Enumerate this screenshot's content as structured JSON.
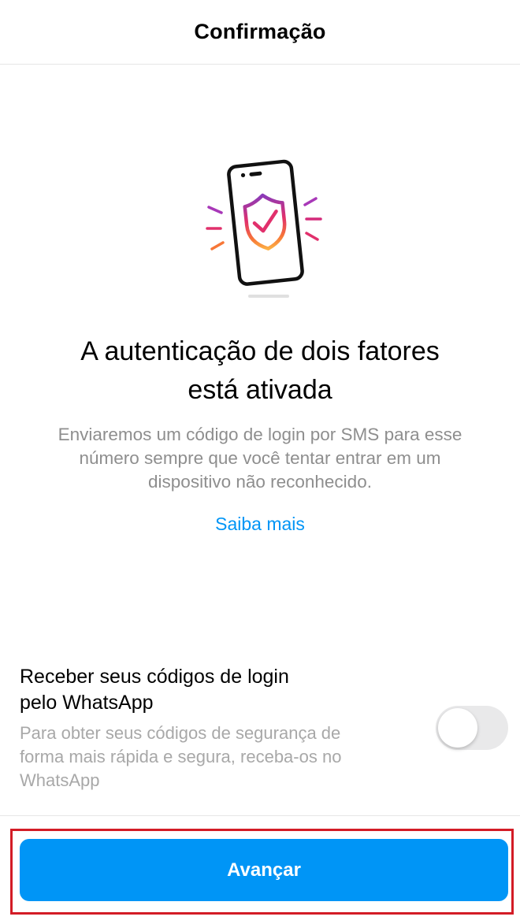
{
  "header": {
    "title": "Confirmação"
  },
  "main": {
    "illustration_icon": "phone-shield-check-icon",
    "headline_line1": "A autenticação de dois fatores",
    "headline_line2": "está ativada",
    "description_line1": "Enviaremos um código de login por SMS para esse",
    "description_line2": "número sempre que você tentar entrar em um",
    "description_line3": "dispositivo não reconhecido.",
    "learn_more": "Saiba mais"
  },
  "whatsapp": {
    "title_line1": "Receber seus códigos de login",
    "title_line2": "pelo WhatsApp",
    "desc_line1": "Para obter seus códigos de segurança de",
    "desc_line2": "forma mais rápida e segura, receba-os no",
    "desc_line3": "WhatsApp",
    "toggle_on": false
  },
  "footer": {
    "next_label": "Avançar"
  },
  "colors": {
    "accent": "#0095f6",
    "highlight": "#d31c26",
    "secondary_text": "#8e8e8e",
    "gradient_stops": [
      "#8a3ab9",
      "#e1306c",
      "#f77737",
      "#fcaf45"
    ]
  }
}
